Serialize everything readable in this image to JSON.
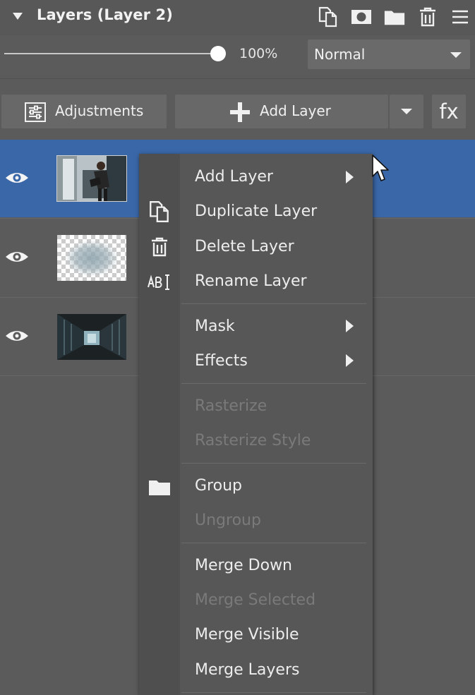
{
  "panel": {
    "title": "Layers (Layer 2)",
    "header_icons": [
      "duplicate-icon",
      "mask-icon",
      "folder-icon",
      "trash-icon",
      "menu-icon"
    ]
  },
  "opacity": {
    "value": "100%",
    "level": 1.0
  },
  "blend_mode": {
    "selected": "Normal"
  },
  "toolbar": {
    "adjustments_label": "Adjustments",
    "add_layer_label": "Add Layer",
    "fx_label": "fx"
  },
  "layers": [
    {
      "visible": true,
      "selected": true,
      "thumb": "person-photo"
    },
    {
      "visible": true,
      "selected": false,
      "thumb": "transparent-mask"
    },
    {
      "visible": true,
      "selected": false,
      "thumb": "corridor-photo"
    }
  ],
  "context_menu": {
    "items": [
      {
        "label": "Add Layer",
        "enabled": true,
        "submenu": true
      },
      {
        "label": "Duplicate Layer",
        "enabled": true,
        "icon": "duplicate-icon"
      },
      {
        "label": "Delete Layer",
        "enabled": true,
        "icon": "trash-icon"
      },
      {
        "label": "Rename Layer",
        "enabled": true,
        "icon": "rename-icon"
      },
      {
        "label": "Mask",
        "enabled": true,
        "submenu": true
      },
      {
        "label": "Effects",
        "enabled": true,
        "submenu": true
      },
      {
        "label": "Rasterize",
        "enabled": false
      },
      {
        "label": "Rasterize Style",
        "enabled": false
      },
      {
        "label": "Group",
        "enabled": true,
        "icon": "folder-icon"
      },
      {
        "label": "Ungroup",
        "enabled": false
      },
      {
        "label": "Merge Down",
        "enabled": true
      },
      {
        "label": "Merge Selected",
        "enabled": false
      },
      {
        "label": "Merge Visible",
        "enabled": true
      },
      {
        "label": "Merge Layers",
        "enabled": true
      }
    ]
  },
  "colors": {
    "panel_bg": "#5b5b5b",
    "selection": "#3a67a8",
    "menu_bg": "#575757",
    "text": "#ececec",
    "disabled_text": "#7a7a7a"
  }
}
